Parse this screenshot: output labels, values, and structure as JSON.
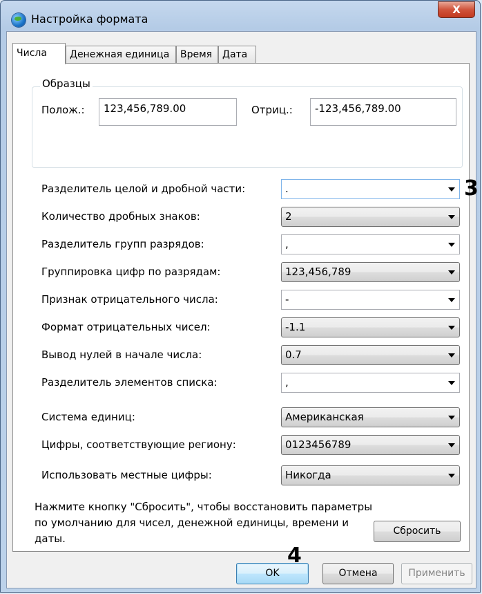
{
  "window": {
    "title": "Настройка формата",
    "close_label": "X"
  },
  "tabs": [
    {
      "label": "Числа",
      "active": true
    },
    {
      "label": "Денежная единица",
      "active": false
    },
    {
      "label": "Время",
      "active": false
    },
    {
      "label": "Дата",
      "active": false
    }
  ],
  "samples": {
    "group_label": "Образцы",
    "positive_label": "Полож.:",
    "positive_value": "123,456,789.00",
    "negative_label": "Отриц.:",
    "negative_value": "-123,456,789.00"
  },
  "settings": [
    {
      "label": "Разделитель целой и дробной части:",
      "value": ".",
      "kind": "edit",
      "focused": true
    },
    {
      "label": "Количество дробных знаков:",
      "value": "2",
      "kind": "list"
    },
    {
      "label": "Разделитель групп разрядов:",
      "value": ",",
      "kind": "edit"
    },
    {
      "label": "Группировка цифр по разрядам:",
      "value": "123,456,789",
      "kind": "list"
    },
    {
      "label": "Признак отрицательного числа:",
      "value": "-",
      "kind": "edit"
    },
    {
      "label": "Формат отрицательных чисел:",
      "value": "-1.1",
      "kind": "list"
    },
    {
      "label": "Вывод нулей в начале числа:",
      "value": "0.7",
      "kind": "list"
    },
    {
      "label": "Разделитель элементов списка:",
      "value": ",",
      "kind": "edit"
    },
    {
      "label": "Система единиц:",
      "value": "Американская",
      "kind": "list"
    },
    {
      "label": "Цифры, соответствующие региону:",
      "value": "0123456789",
      "kind": "list"
    },
    {
      "label": "Использовать местные цифры:",
      "value": "Никогда",
      "kind": "list"
    }
  ],
  "note": "Нажмите кнопку \"Сбросить\", чтобы восстановить параметры по умолчанию для чисел, денежной единицы, времени и даты.",
  "buttons": {
    "reset": "Сбросить",
    "ok": "OK",
    "cancel": "Отмена",
    "apply": "Применить"
  },
  "annotations": {
    "marker_3": "3",
    "marker_4": "4"
  }
}
